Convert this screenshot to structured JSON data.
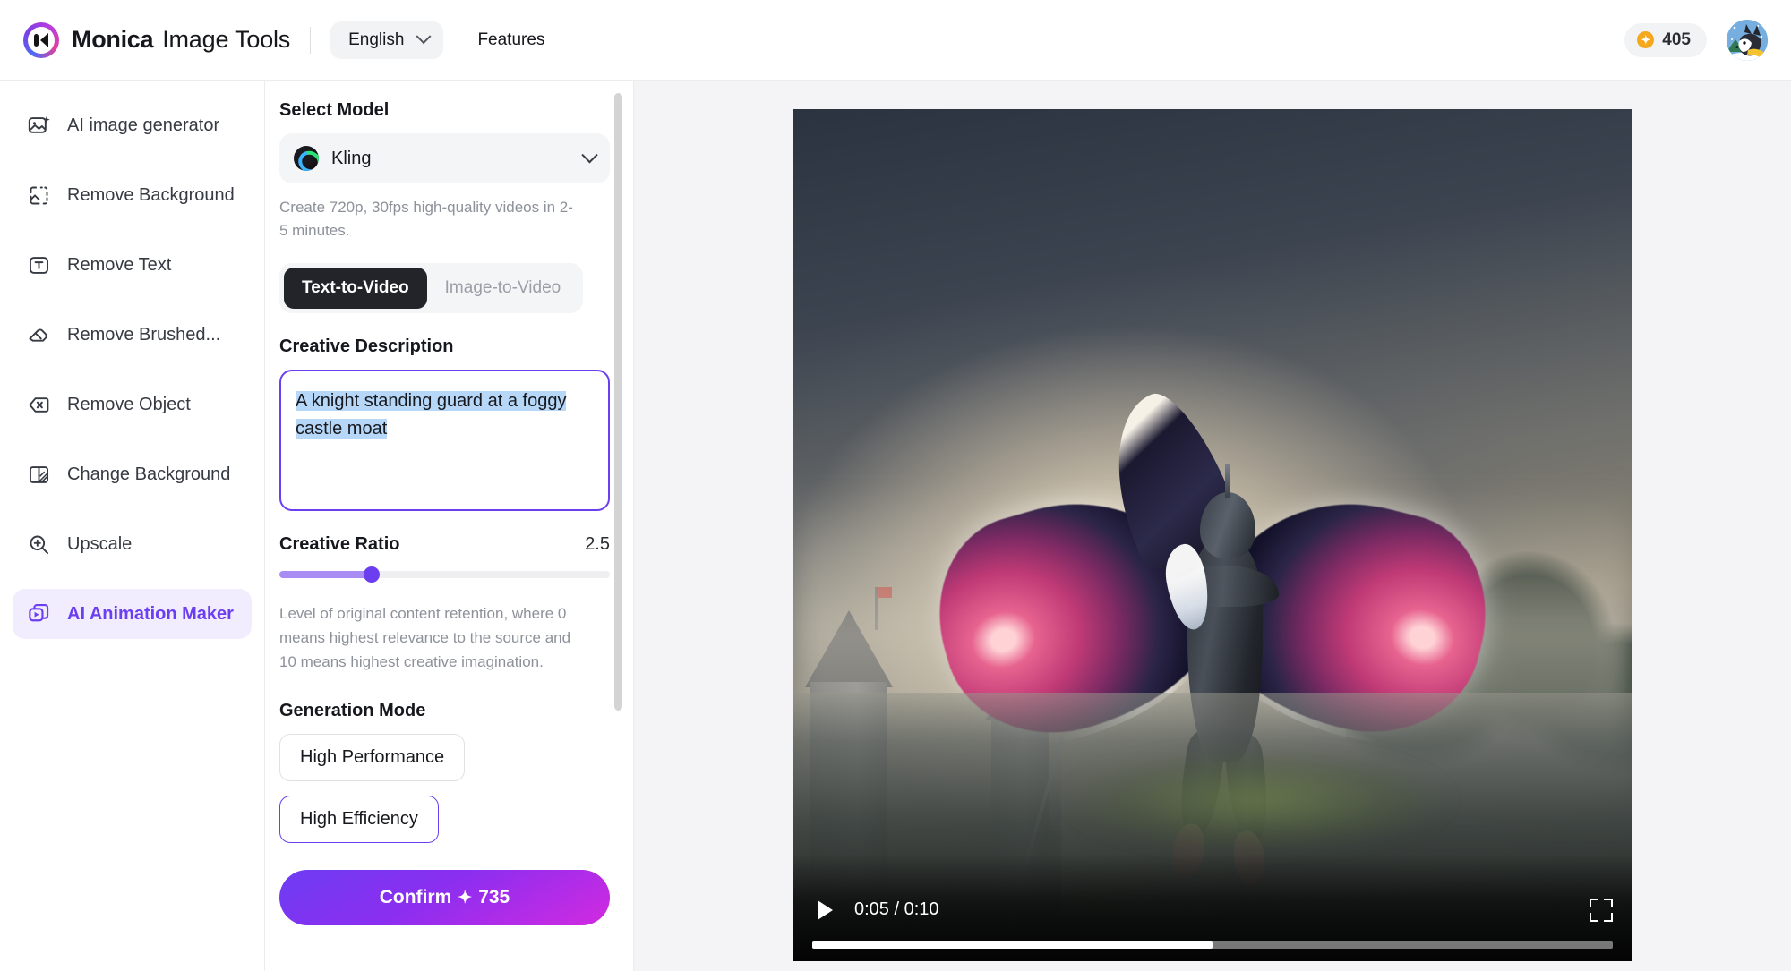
{
  "header": {
    "brand_name": "Monica",
    "brand_sub": "Image Tools",
    "language": "English",
    "features_label": "Features",
    "credits": "405",
    "coin_icon": "coin-icon",
    "avatar_icon": "user-avatar-husky"
  },
  "sidebar": {
    "items": [
      {
        "label": "AI image generator",
        "icon": "image-sparkle-icon",
        "active": false
      },
      {
        "label": "Remove Background",
        "icon": "dashed-frame-icon",
        "active": false
      },
      {
        "label": "Remove Text",
        "icon": "text-box-icon",
        "active": false
      },
      {
        "label": "Remove Brushed...",
        "icon": "eraser-icon",
        "active": false
      },
      {
        "label": "Remove Object",
        "icon": "object-x-icon",
        "active": false
      },
      {
        "label": "Change Background",
        "icon": "split-panel-icon",
        "active": false
      },
      {
        "label": "Upscale",
        "icon": "magnifier-plus-icon",
        "active": false
      },
      {
        "label": "AI Animation Maker",
        "icon": "video-layers-icon",
        "active": true
      }
    ]
  },
  "panel": {
    "select_model_label": "Select Model",
    "model_name": "Kling",
    "model_icon": "kling-logo-icon",
    "model_description": "Create 720p, 30fps high-quality videos in 2-5 minutes.",
    "tabs": [
      {
        "label": "Text-to-Video",
        "active": true
      },
      {
        "label": "Image-to-Video",
        "active": false
      }
    ],
    "creative_description_label": "Creative Description",
    "creative_description_value": "A knight standing guard at a foggy castle moat",
    "creative_ratio_label": "Creative Ratio",
    "creative_ratio_value": "2.5",
    "creative_ratio_percent": 28,
    "creative_ratio_description": "Level of original content retention, where 0 means highest relevance to the source and 10 means highest creative imagination.",
    "generation_mode_label": "Generation Mode",
    "generation_modes": [
      {
        "label": "High Performance",
        "selected": false
      },
      {
        "label": "High Efficiency",
        "selected": true
      }
    ],
    "confirm_label": "Confirm",
    "confirm_spark": "✦",
    "confirm_cost": "735"
  },
  "preview": {
    "video_alt": "Winged knight in dark armor with large pink feathered wings flying over a foggy castle moat",
    "current_time": "0:05",
    "duration": "0:10",
    "time_display": "0:05 / 0:10",
    "progress_percent": 50,
    "play_icon": "play-icon",
    "fullscreen_icon": "fullscreen-icon"
  },
  "colors": {
    "accent_purple": "#6b3ff0",
    "accent_light": "#f1ecfe",
    "slider_track_fill": "#a98df5",
    "confirm_gradient_start": "#6d3df2",
    "confirm_gradient_end": "#d22ae0",
    "selection_highlight": "#b6d7f7",
    "coin": "#f6a81c",
    "tab_active_bg": "#232429"
  }
}
